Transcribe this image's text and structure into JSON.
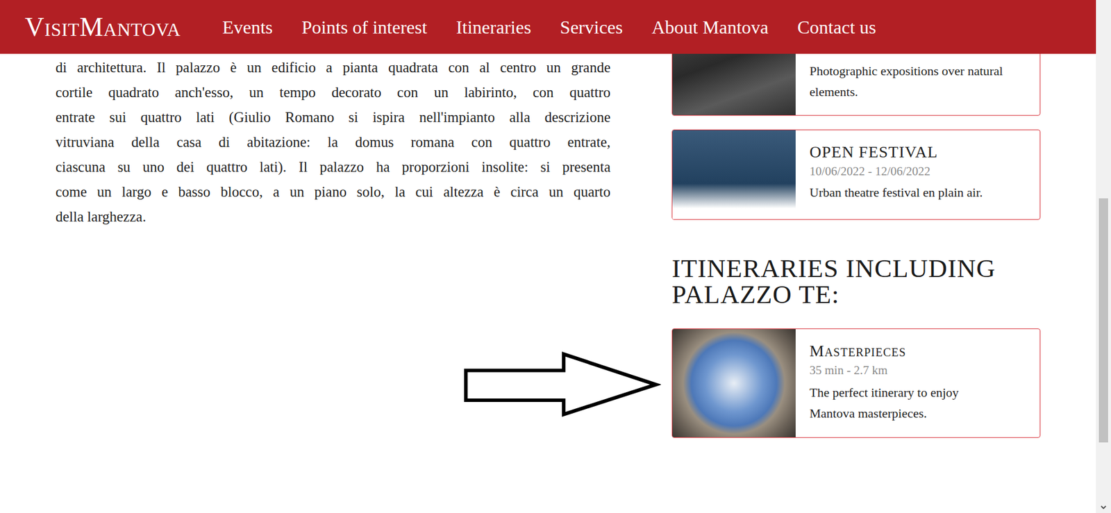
{
  "header": {
    "logo": "VisitMantova",
    "nav": [
      "Events",
      "Points of interest",
      "Itineraries",
      "Services",
      "About Mantova",
      "Contact us"
    ]
  },
  "article": {
    "lines": [
      "di architettura. Il palazzo è un edificio a pianta quadrata con al centro un grande",
      "cortile quadrato anch'esso, un tempo decorato con un labirinto, con quattro",
      "entrate sui quattro lati (Giulio Romano si ispira nell'impianto alla descrizione",
      "vitruviana della casa di abitazione: la domus romana con quattro entrate,",
      "ciascuna su uno dei quattro lati). Il palazzo ha proporzioni insolite: si presenta",
      "come un largo e basso blocco, a un piano solo, la cui altezza è circa un quarto",
      "della larghezza."
    ]
  },
  "events": [
    {
      "description": "Photographic expositions over natural elements."
    },
    {
      "title": "OPEN FESTIVAL",
      "dates": "10/06/2022 - 12/06/2022",
      "description": "Urban theatre festival en plain air."
    }
  ],
  "itineraries": {
    "heading": "ITINERARIES INCLUDING PALAZZO TE:",
    "items": [
      {
        "title": "Masterpieces",
        "meta": "35 min - 2.7 km",
        "description": "The perfect itinerary to enjoy Mantova masterpieces."
      }
    ]
  }
}
